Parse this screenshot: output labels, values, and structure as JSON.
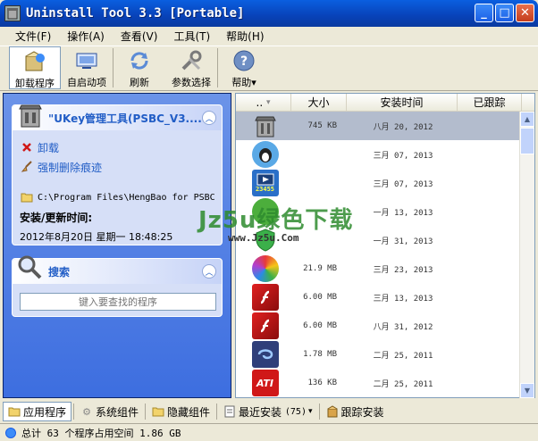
{
  "window": {
    "title": "Uninstall Tool 3.3 [Portable]",
    "minimize_glyph": "_",
    "maximize_glyph": "□",
    "close_glyph": "✕"
  },
  "menu": [
    "文件(F)",
    "操作(A)",
    "查看(V)",
    "工具(T)",
    "帮助(H)"
  ],
  "toolbar": {
    "uninstall": "卸载程序",
    "startup": "自启动项",
    "refresh": "刷新",
    "settings": "参数选择",
    "help": "帮助",
    "help_arrow": "▾"
  },
  "program_card": {
    "title": "\"UKey管理工具(PSBC_V3....",
    "uninstall_action": "卸载",
    "force_remove_action": "强制删除痕迹",
    "install_path": "C:\\Program Files\\HengBao for PSBC",
    "install_time_label": "安装/更新时间:",
    "install_time_value": "2012年8月20日 星期一 18:48:25"
  },
  "search_card": {
    "title": "搜索",
    "placeholder": "键入要查找的程序"
  },
  "list": {
    "columns": [
      "..",
      "大小",
      "安装时间",
      "已跟踪"
    ],
    "sort_glyph": "▾",
    "rows": [
      {
        "icon": "uninstall-tool-icon",
        "size": "745 KB",
        "date": "八月 20, 2012",
        "selected": true
      },
      {
        "icon": "qq-penguin-icon",
        "size": "",
        "date": "三月 07, 2013",
        "selected": false
      },
      {
        "icon": "film-player-icon",
        "size": "",
        "date": "三月 07, 2013",
        "selected": false
      },
      {
        "icon": "green-circle-icon",
        "size": "",
        "date": "一月 13, 2013",
        "selected": false
      },
      {
        "icon": "shield-icon",
        "size": "",
        "date": "一月 31, 2013",
        "selected": false
      },
      {
        "icon": "colorful-ball-icon",
        "size": "21.9 MB",
        "date": "三月 23, 2013",
        "selected": false
      },
      {
        "icon": "flash-player-icon",
        "size": "6.00 MB",
        "date": "三月 13, 2013",
        "selected": false
      },
      {
        "icon": "flash-player-icon",
        "size": "6.00 MB",
        "date": "八月 31, 2012",
        "selected": false
      },
      {
        "icon": "blue-swirl-icon",
        "size": "1.78 MB",
        "date": "二月 25, 2011",
        "selected": false
      },
      {
        "icon": "ati-icon",
        "size": "136 KB",
        "date": "二月 25, 2011",
        "selected": false
      }
    ],
    "icon_text": {
      "ati": "ATI",
      "numbers": "23455"
    }
  },
  "watermark": {
    "main": "Jz5u绿色下载",
    "sub": "www.Jz5u.Com"
  },
  "tabs": {
    "apps": "应用程序",
    "system": "系统组件",
    "hidden": "隐藏组件",
    "recent": "最近安装",
    "recent_count": "(75)",
    "recent_arrow": "▾",
    "tracked": "跟踪安装"
  },
  "status": {
    "text": "总计 63 个程序占用空间 1.86 GB"
  },
  "colors": {
    "titlebar": "#0842b8",
    "panel": "#3d6ee0",
    "selected_row": "#b3bccd"
  }
}
